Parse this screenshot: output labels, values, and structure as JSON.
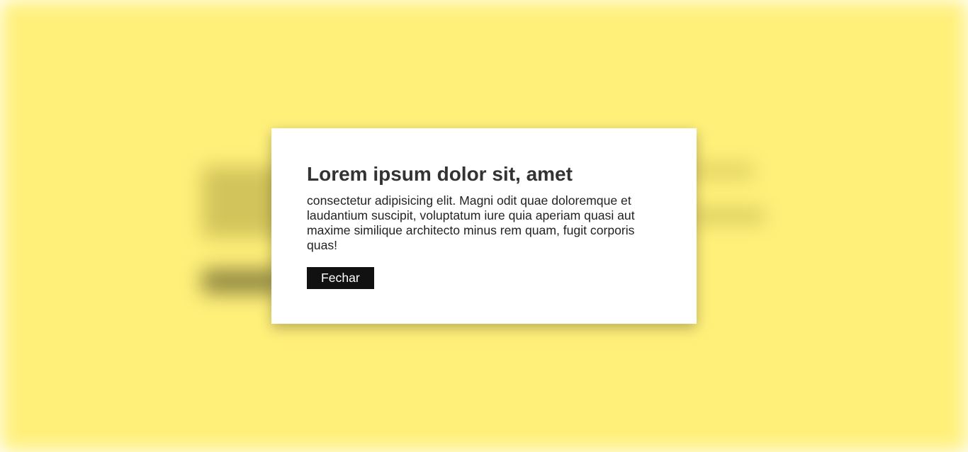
{
  "modal": {
    "title": "Lorem ipsum dolor sit, amet",
    "body": "consectetur adipisicing elit. Magni odit quae doloremque et laudantium suscipit, voluptatum iure quia aperiam quasi aut maxime similique architecto minus rem quam, fugit corporis quas!",
    "close_label": "Fechar"
  },
  "colors": {
    "backdrop": "#fff07a",
    "modal_bg": "#ffffff",
    "button_bg": "#111111",
    "button_text": "#ffffff",
    "title_text": "#333333"
  }
}
